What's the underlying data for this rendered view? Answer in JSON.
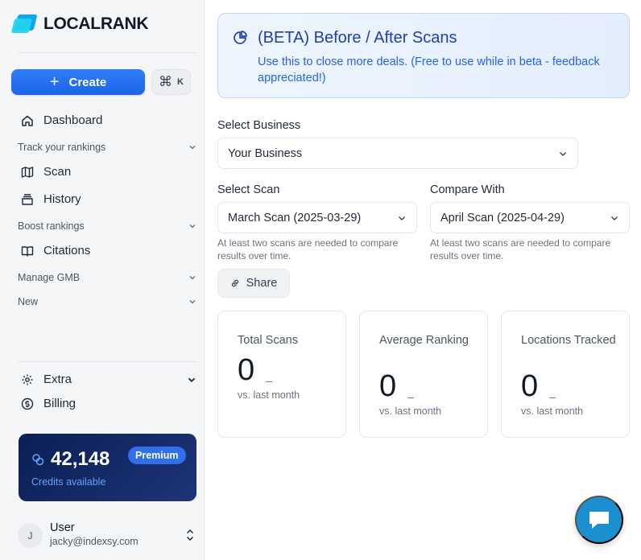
{
  "brand": {
    "name": "LOCALRANK"
  },
  "sidebar": {
    "create_label": "Create",
    "shortcut_key": "K",
    "items": {
      "dashboard": "Dashboard",
      "scan": "Scan",
      "history": "History",
      "citations": "Citations",
      "extra": "Extra",
      "billing": "Billing"
    },
    "groups": {
      "track": "Track your rankings",
      "boost": "Boost rankings",
      "gmb": "Manage GMB",
      "new": "New"
    },
    "credits": {
      "amount": "42,148",
      "label": "Credits available",
      "badge": "Premium"
    },
    "user": {
      "initial": "J",
      "name": "User",
      "email": "jacky@indexsy.com"
    }
  },
  "banner": {
    "title": "(BETA) Before / After Scans",
    "description": "Use this to close more deals. (Free to use while in beta - feedback appreciated!)"
  },
  "form": {
    "business_label": "Select Business",
    "business_value": "Your Business",
    "scan_label": "Select Scan",
    "scan_value": "March Scan (2025-03-29)",
    "compare_label": "Compare With",
    "compare_value": "April Scan (2025-04-29)",
    "hint": "At least two scans are needed to compare results over time.",
    "share_label": "Share"
  },
  "stats": [
    {
      "title": "Total Scans",
      "value": "0",
      "delta": "_",
      "sub": "vs. last month"
    },
    {
      "title": "Average Ranking",
      "value": "0",
      "delta": "_",
      "sub": "vs. last month"
    },
    {
      "title": "Locations Tracked",
      "value": "0",
      "delta": "_",
      "sub": "vs. last month"
    }
  ],
  "colors": {
    "accent": "#2f7df6",
    "banner_text": "#1e40af",
    "credits_bg": "#0b1f55",
    "chat": "#1c8fd1"
  }
}
